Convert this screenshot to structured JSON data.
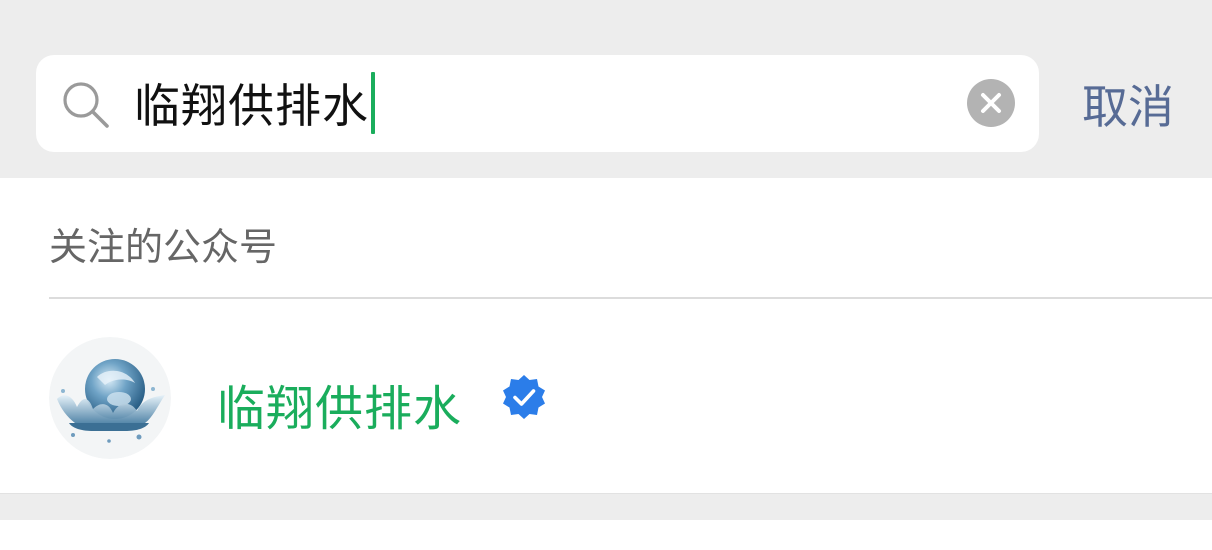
{
  "search": {
    "query": "临翔供排水",
    "cancel_label": "取消"
  },
  "results": {
    "section_header": "关注的公众号",
    "items": [
      {
        "name": "临翔供排水",
        "verified": true,
        "avatar": "water-splash-globe-logo"
      }
    ]
  },
  "colors": {
    "accent_green": "#1aad5c",
    "link_blue": "#576b95",
    "verified_blue": "#2b7de9",
    "background": "#ededed"
  },
  "icons": [
    "search-icon",
    "clear-icon",
    "verified-icon"
  ]
}
